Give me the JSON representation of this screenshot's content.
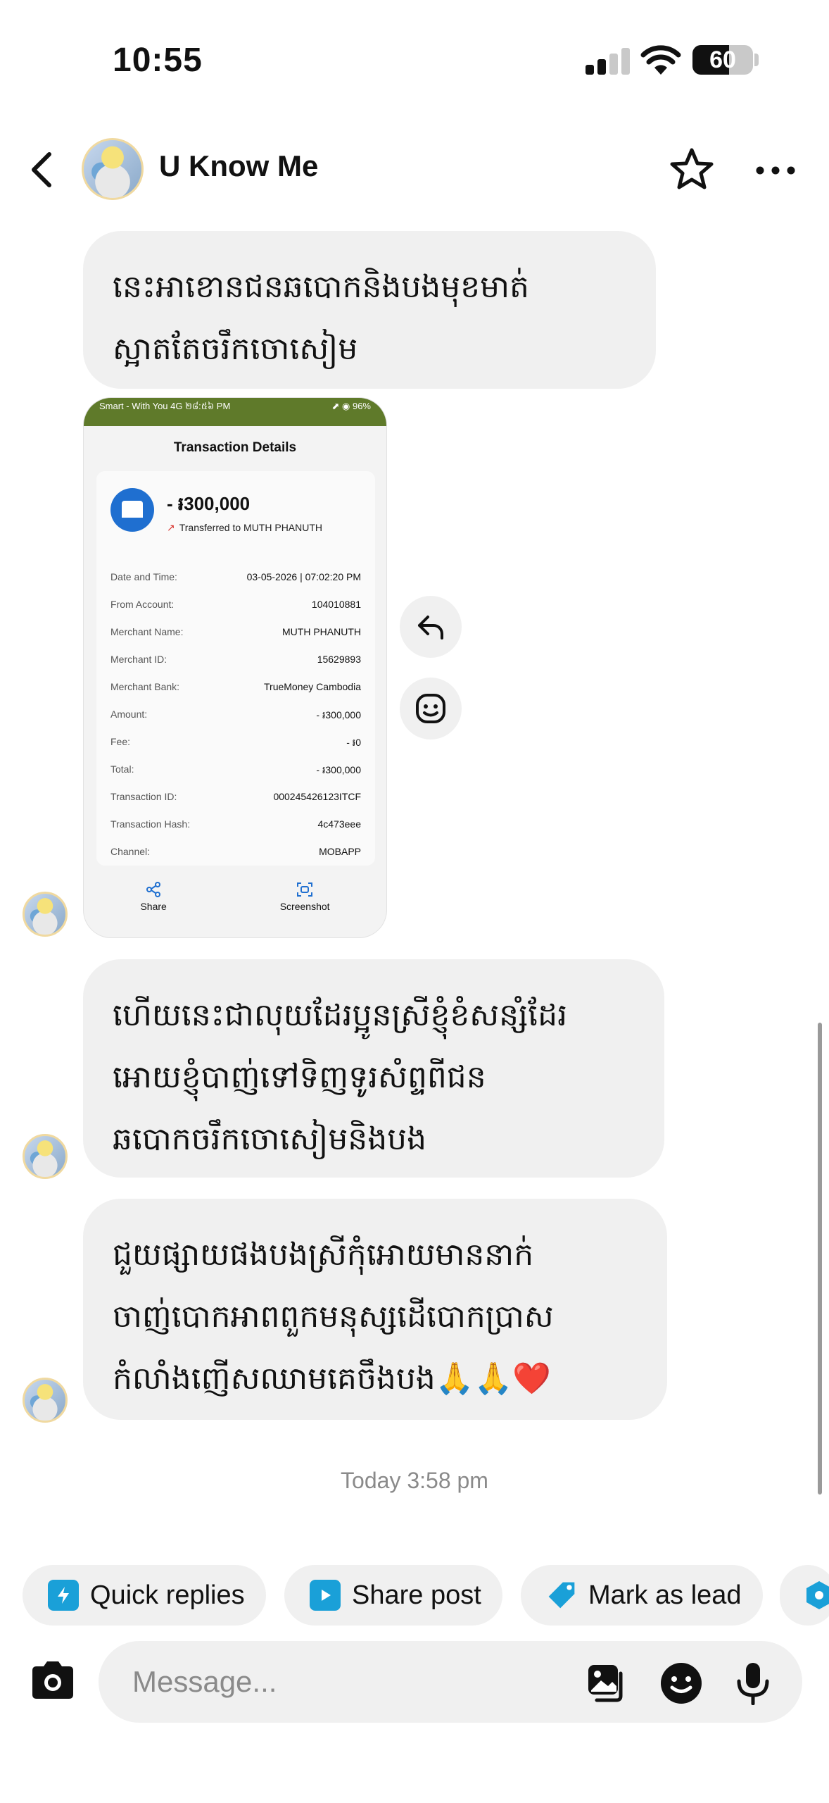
{
  "status_bar": {
    "time": "10:55",
    "battery": "60",
    "battery_level": 0.6
  },
  "header": {
    "contact_name": "U Know Me"
  },
  "messages": [
    {
      "text": "នេះអាខោនជនឆបោកនិងបងមុខមាត់ស្អាតតែចរឹកចោសៀម"
    },
    {
      "text": "ហើយនេះជាលុយដែរប្អូនស្រីខ្ញុំខំសន្សំដែរអោយខ្ញុំបាញ់ទៅទិញទូរសំព្ទពីជនឆបោកចរឹកចោសៀមនិងបង"
    },
    {
      "text": "ជួយផ្សាយផងបងស្រីកុំអោយមាននាក់ចាញ់បោកអាពពួកមនុស្សដើបោកប្រាសកំលាំងញើសឈាមគេចឹងបង🙏🙏❤️"
    }
  ],
  "receipt": {
    "status_left": "Smart - With You  4G  ២៨:៥៦ PM",
    "status_right": "⬈ ◉ 96%",
    "title": "Transaction Details",
    "amount": "- ៛300,000",
    "transferred_to": "Transferred to MUTH PHANUTH",
    "rows": [
      {
        "label": "Date and Time:",
        "value": "03-05-2026 | 07:02:20 PM"
      },
      {
        "label": "From Account:",
        "value": "104010881"
      },
      {
        "label": "Merchant Name:",
        "value": "MUTH PHANUTH"
      },
      {
        "label": "Merchant ID:",
        "value": "15629893"
      },
      {
        "label": "Merchant Bank:",
        "value": "TrueMoney Cambodia"
      },
      {
        "label": "Amount:",
        "value": "- ៛300,000"
      },
      {
        "label": "Fee:",
        "value": "- ៛0"
      },
      {
        "label": "Total:",
        "value": "- ៛300,000"
      },
      {
        "label": "Transaction ID:",
        "value": "000245426123ITCF"
      },
      {
        "label": "Transaction Hash:",
        "value": "4c473eee"
      },
      {
        "label": "Channel:",
        "value": "MOBAPP"
      }
    ],
    "share_label": "Share",
    "screenshot_label": "Screenshot"
  },
  "timestamp": "Today 3:58 pm",
  "quick_actions": {
    "quick_replies": "Quick replies",
    "share_post": "Share post",
    "mark_as_lead": "Mark as lead"
  },
  "composer": {
    "placeholder": "Message..."
  },
  "colors": {
    "accent": "#1aa0d8",
    "bubble": "#f0f0f0",
    "receipt_header": "#5f7a2a",
    "brand_blue": "#1f6fd0"
  }
}
